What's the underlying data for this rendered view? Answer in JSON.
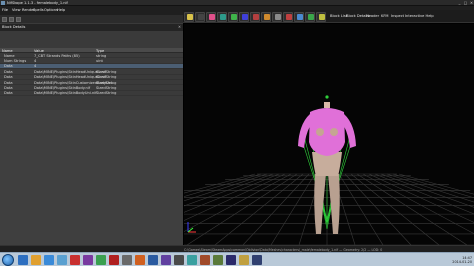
{
  "window": {
    "title": "NifSkope 1.1.3 - femalebody_1.nif",
    "minimize_label": "_",
    "maximize_label": "□",
    "close_label": "✕"
  },
  "menu": [
    "File",
    "View",
    "Render",
    "Spells",
    "Options",
    "Help"
  ],
  "toolbar": {
    "block_list_label": "Block List",
    "block_details_label": "Block Details",
    "header_label": "Header",
    "kfm_label": "KFM",
    "inspect_label": "Inspect",
    "interactive_help_label": "Interactive Help",
    "button_colors": [
      "#d8c24a",
      "#444444",
      "#e0508a",
      "#2d9a8a",
      "#3fb34a",
      "#3f3fd9",
      "#b33f3f",
      "#d08a2d",
      "#8a8a8a",
      "#c04040",
      "#4a8ad0",
      "#3aa64a",
      "#c0c040"
    ]
  },
  "left_panel": {
    "block_title": "Block Details",
    "close_label": "✕",
    "columns": [
      "Name",
      "Value",
      "Type"
    ],
    "rows": [
      {
        "name": "Name",
        "value": "7_CBT Strands Paths (85)",
        "type": "string",
        "selected": false
      },
      {
        "name": "Num Strings",
        "value": "4",
        "type": "uint",
        "selected": false
      },
      {
        "name": "Data",
        "value": "4",
        "type": "",
        "selected": true
      },
      {
        "name": "Data",
        "value": "Data\\MINE\\Plugins\\SkinHeadUnique1.nif",
        "type": "SizedString",
        "selected": false
      },
      {
        "name": "Data",
        "value": "Data\\MINE\\Plugins\\SkinHeadUnique2.nif",
        "type": "SizedString",
        "selected": false
      },
      {
        "name": "Data",
        "value": "Data\\MINE\\Plugins\\SkinCustomizedBodyUni...",
        "type": "SizedString",
        "selected": false
      },
      {
        "name": "Data",
        "value": "Data\\MINE\\Plugins\\SkinBody.nif",
        "type": "SizedString",
        "selected": false
      },
      {
        "name": "Data",
        "value": "Data\\MINE\\Plugins\\SkinBodyUni.nif",
        "type": "SizedString",
        "selected": false
      }
    ],
    "bottom_tabs": [
      "Block List",
      "Header",
      "Archive Browser"
    ]
  },
  "status": {
    "text": "C:\\Games\\Steam\\SteamApps\\common\\Oblivion\\Data\\Meshes\\characters\\_male\\femalebody_1.nif — Geometry: 2/2 — LOD: 0"
  },
  "taskbar": {
    "time": "14:47",
    "date": "2014-01-20",
    "app_colors": [
      "#2d6fc0",
      "#e0a030",
      "#3a8ad8",
      "#5aa0d0",
      "#c83030",
      "#7a3aa0",
      "#3aa050",
      "#b02020",
      "#6a6a6a",
      "#d06020",
      "#2a5aa0",
      "#6040a0",
      "#4a4a4a",
      "#3aa0a0",
      "#a04a2a",
      "#5a7a3a",
      "#2a2a6a",
      "#c0a040",
      "#304070"
    ]
  },
  "viewport": {
    "model_color": "#e070d8",
    "skin_color": "#b8a090",
    "skeleton_color": "#2ecf3a",
    "grid_color": "#3a3a3a"
  }
}
